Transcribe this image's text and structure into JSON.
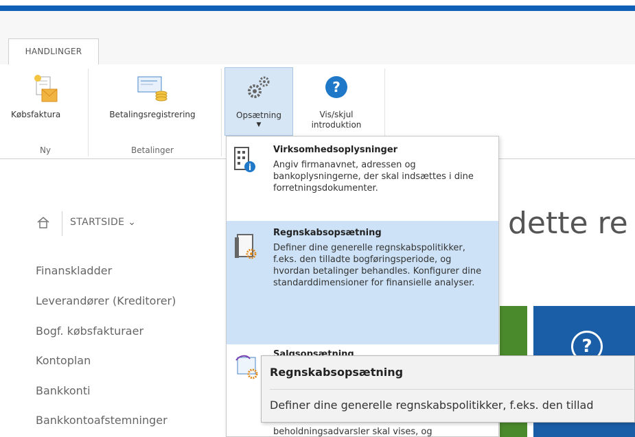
{
  "ribbon": {
    "tab_label": "HANDLINGER",
    "groups": {
      "ny": "Ny",
      "betalinger": "Betalinger"
    },
    "buttons": {
      "kobsfaktura": "Købsfaktura",
      "betalingsregistrering": "Betalingsregistrering",
      "opsaetning": "Opsætning",
      "vis_skjul_line1": "Vis/skjul",
      "vis_skjul_line2": "introduktion"
    }
  },
  "nav": {
    "startside": "STARTSIDE",
    "items": [
      "Finanskladder",
      "Leverandører (Kreditorer)",
      "Bogf. købsfakturaer",
      "Kontoplan",
      "Bankkonti",
      "Bankkontoafstemninger"
    ]
  },
  "main": {
    "heading_partial": "dette re"
  },
  "dropdown": {
    "items": [
      {
        "title": "Virksomhedsoplysninger",
        "description": "Angiv firmanavnet, adressen og bankoplysningerne, der skal indsættes i dine forretningsdokumenter."
      },
      {
        "title": "Regnskabsopsætning",
        "description": "Definer dine generelle regnskabspolitikker, f.eks. den tilladte bogføringsperiode, og hvordan betalinger behandles. Konfigurer dine standarddimensioner for finansielle analyser."
      },
      {
        "title": "Salgsopsætning",
        "description_tail": "beholdningsadvarsler skal vises, og"
      }
    ]
  },
  "tooltip": {
    "title": "Regnskabsopsætning",
    "text": "Definer dine generelle regnskabspolitikker, f.eks. den tillad"
  },
  "colors": {
    "top_bar": "#1060b8",
    "hover_bg": "#cde2f6",
    "tile_green": "#4b8a2c",
    "tile_blue": "#1b5ea8"
  }
}
